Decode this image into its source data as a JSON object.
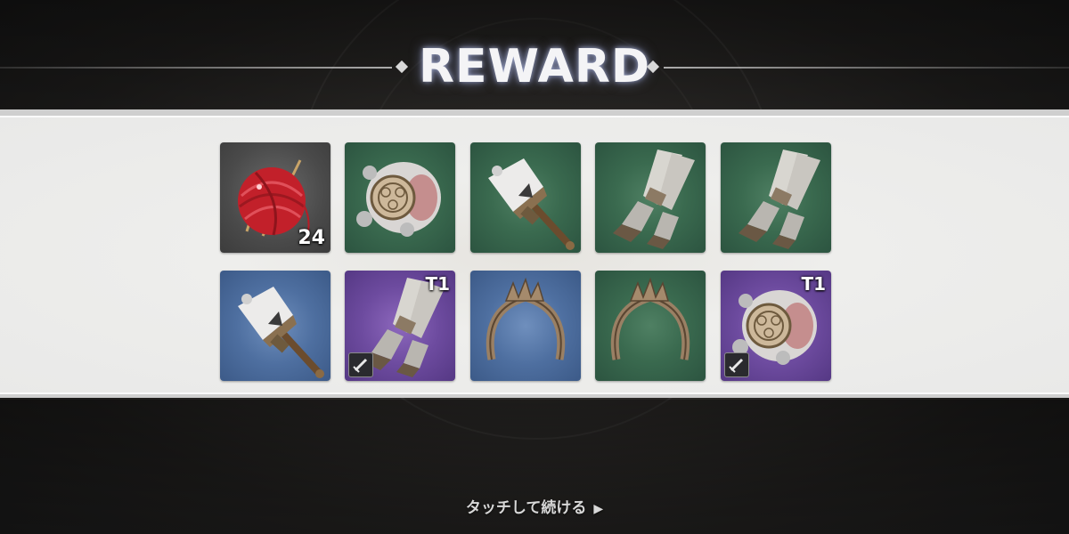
{
  "title": "REWARD",
  "continue_prompt": "タッチして続ける",
  "continue_arrow": "▶",
  "rows": [
    [
      {
        "item": "red-yarn-ball",
        "rarity": "gray",
        "quantity": "24",
        "tier": "",
        "weapon_badge": false
      },
      {
        "item": "gauntlet-medallion",
        "rarity": "green",
        "quantity": "",
        "tier": "",
        "weapon_badge": false
      },
      {
        "item": "fist-scepter",
        "rarity": "green",
        "quantity": "",
        "tier": "",
        "weapon_badge": false
      },
      {
        "item": "armored-gloves",
        "rarity": "green",
        "quantity": "",
        "tier": "",
        "weapon_badge": false
      },
      {
        "item": "armored-gloves",
        "rarity": "green",
        "quantity": "",
        "tier": "",
        "weapon_badge": false
      }
    ],
    [
      {
        "item": "fist-scepter",
        "rarity": "blue",
        "quantity": "",
        "tier": "",
        "weapon_badge": false
      },
      {
        "item": "armored-gloves",
        "rarity": "purple",
        "quantity": "",
        "tier": "T1",
        "weapon_badge": true
      },
      {
        "item": "spiked-circlet",
        "rarity": "blue",
        "quantity": "",
        "tier": "",
        "weapon_badge": false
      },
      {
        "item": "spiked-circlet",
        "rarity": "green",
        "quantity": "",
        "tier": "",
        "weapon_badge": false
      },
      {
        "item": "gauntlet-medallion",
        "rarity": "purple",
        "quantity": "",
        "tier": "T1",
        "weapon_badge": true
      }
    ]
  ],
  "colors": {
    "gray": "#4a4a4a",
    "green": "#3a6a4f",
    "blue": "#4e6fa0",
    "purple": "#6d4b9f"
  }
}
